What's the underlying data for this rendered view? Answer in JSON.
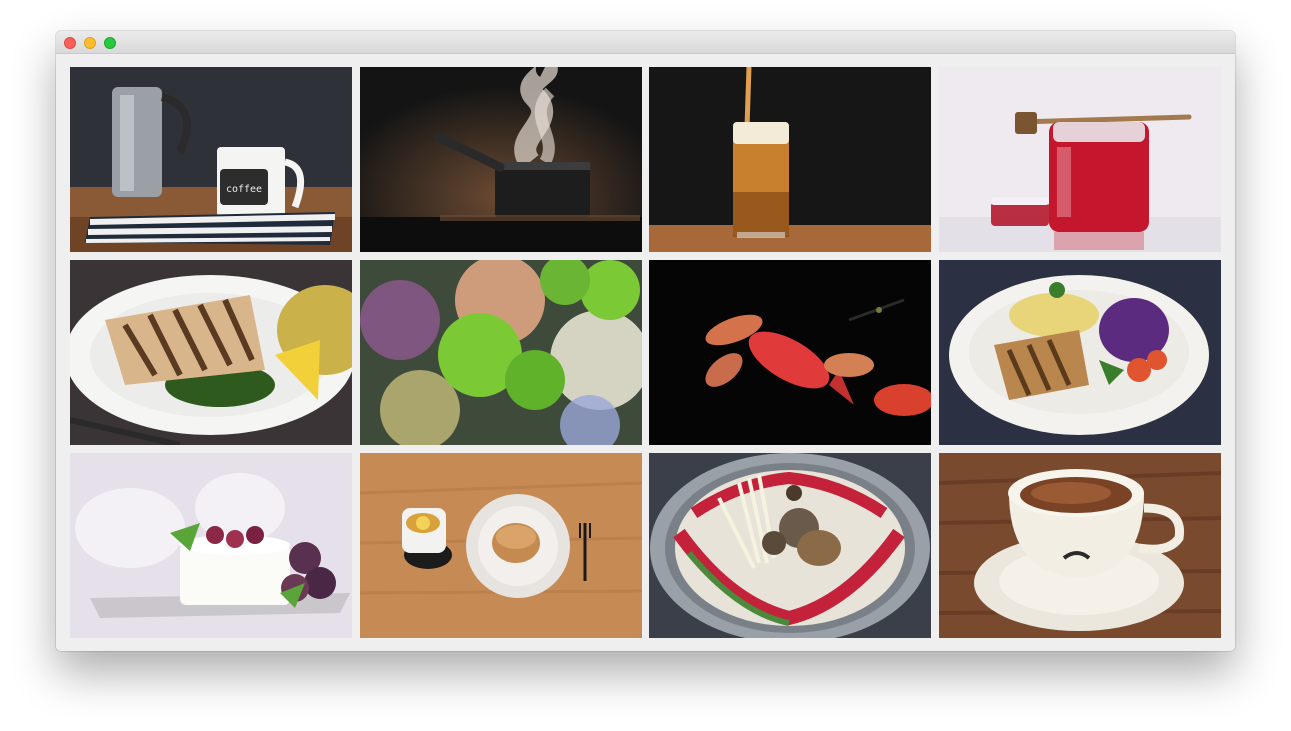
{
  "window": {
    "title": "",
    "controls": [
      "close",
      "minimize",
      "zoom"
    ]
  },
  "gallery": {
    "tiles": [
      {
        "subject": "coffee-moka-pot-and-mug",
        "mug_text": "coffee"
      },
      {
        "subject": "steaming-pot"
      },
      {
        "subject": "pouring-beer"
      },
      {
        "subject": "honey-jar-with-dipper"
      },
      {
        "subject": "grilled-fish-plate"
      },
      {
        "subject": "green-chrysanthemum-flowers"
      },
      {
        "subject": "goldfish-aquarium"
      },
      {
        "subject": "grilled-chicken-plate"
      },
      {
        "subject": "cream-cake-with-grapes"
      },
      {
        "subject": "tea-and-pastry-on-table"
      },
      {
        "subject": "mushroom-hot-pot"
      },
      {
        "subject": "espresso-cup-on-wood"
      }
    ]
  },
  "colors": {
    "close": "#fc5f57",
    "minimize": "#fdbc2e",
    "zoom": "#28c840",
    "window_background": "#efefef"
  }
}
